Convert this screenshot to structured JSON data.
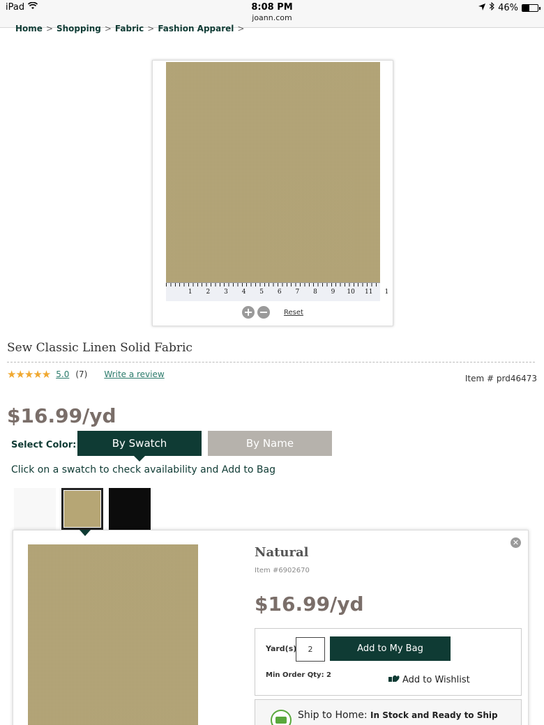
{
  "status_bar": {
    "device": "iPad",
    "time": "8:08 PM",
    "url": "joann.com",
    "battery": "46%",
    "battery_level": 0.46
  },
  "breadcrumb": [
    "Home",
    "Shopping",
    "Fabric",
    "Fashion Apparel"
  ],
  "viewer": {
    "ruler_numbers": [
      "1",
      "2",
      "3",
      "4",
      "5",
      "6",
      "7",
      "8",
      "9",
      "10",
      "11",
      "1"
    ],
    "zoom_in": "+",
    "zoom_out": "−",
    "reset": "Reset"
  },
  "product": {
    "title": "Sew Classic Linen Solid Fabric",
    "stars": "★★★★★",
    "rating": "5.0",
    "review_count": "(7)",
    "write_review": "Write a review",
    "item_number": "Item # prd46473",
    "price": "$16.99/yd"
  },
  "color_select": {
    "label": "Select Color:",
    "tab_swatch": "By Swatch",
    "tab_name": "By Name",
    "instruction": "Click on a swatch to check availability and Add to Bag",
    "swatches": [
      {
        "name": "Natural",
        "color": "#b6a675",
        "selected": true
      },
      {
        "name": "Black",
        "color": "#0c0c0c",
        "selected": false
      }
    ]
  },
  "detail": {
    "color_name": "Natural",
    "item": "Item #6902670",
    "price": "$16.99/yd",
    "yards_label": "Yard(s)",
    "yards_value": "2",
    "add_to_bag": "Add to My Bag",
    "min_order": "Min Order Qty: 2",
    "wishlist": "Add to Wishlist",
    "ship_label": "Ship to Home:",
    "ship_status": "In Stock and Ready to Ship"
  },
  "colors": {
    "brand_green": "#0f3b34",
    "fabric": "#b6a675",
    "price_gray": "#7a6e69",
    "star": "#f0a830"
  }
}
